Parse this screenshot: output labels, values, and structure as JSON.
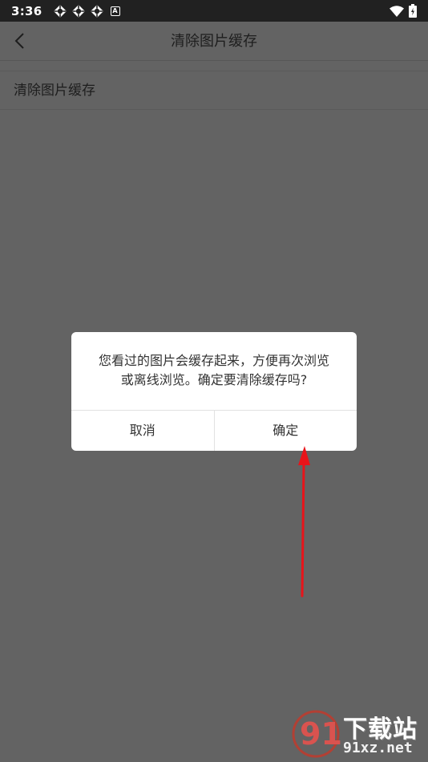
{
  "status_bar": {
    "time": "3:36",
    "notification_icons": [
      "app-notification-icon",
      "app-notification-icon",
      "app-notification-icon"
    ],
    "a_badge": "A",
    "right_icons": [
      "wifi-icon",
      "battery-icon"
    ]
  },
  "app_bar": {
    "back_icon": "chevron-left-icon",
    "title": "清除图片缓存"
  },
  "list": {
    "items": [
      {
        "label": "清除图片缓存"
      }
    ]
  },
  "dialog": {
    "message_line1": "您看过的图片会缓存起来，方便再次浏览",
    "message_line2": "或离线浏览。确定要清除缓存吗?",
    "cancel_label": "取消",
    "confirm_label": "确定"
  },
  "annotation": {
    "arrow_color": "#e8141a",
    "points_to": "confirm-button"
  },
  "watermark": {
    "mark_text": "91",
    "title": "下载站",
    "url": "91xz.net"
  },
  "colors": {
    "overlay_background": "#636363",
    "status_bar": "#212121",
    "dialog_background": "#ffffff",
    "dialog_divider": "#e2e2e2",
    "text_primary": "#333333"
  }
}
